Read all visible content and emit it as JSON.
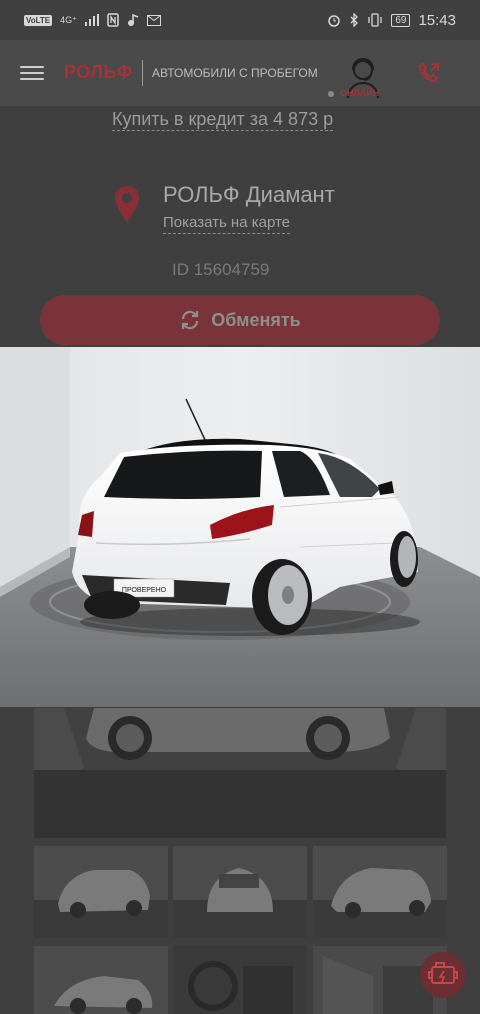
{
  "status_bar": {
    "volte": "VoLTE",
    "network": "4G⁺",
    "time": "15:43",
    "battery": "69"
  },
  "header": {
    "logo": "РОЛЬФ",
    "subtitle": "АВТОМОБИЛИ С ПРОБЕГОМ",
    "online": "ОНЛАЙН"
  },
  "offer": {
    "credit_link": "Купить в кредит за 4 873 р",
    "dealer_name": "РОЛЬФ Диамант",
    "map_link": "Показать на карте",
    "car_id": "ID 15604759",
    "exchange_label": "Обменять"
  },
  "photo": {
    "plate_text": "ПРОВЕРЕНО"
  },
  "colors": {
    "accent": "#a8323a",
    "overlay": "#3f3f3f"
  },
  "icons": [
    "menu-icon",
    "consultant-icon",
    "phone-icon",
    "location-pin-icon",
    "exchange-icon",
    "fab-engine-icon"
  ]
}
